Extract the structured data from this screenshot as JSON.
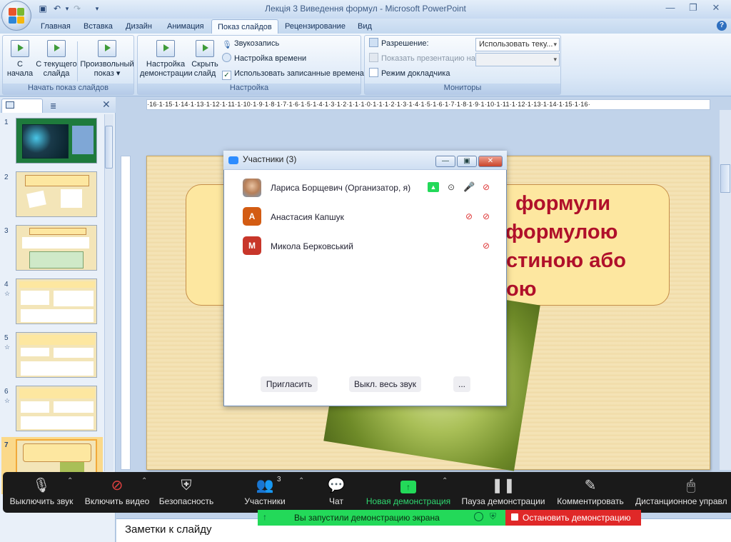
{
  "window": {
    "title": "Лекція 3 Виведення формул - Microsoft PowerPoint"
  },
  "ribbon": {
    "tabs": [
      "Главная",
      "Вставка",
      "Дизайн",
      "Анимация",
      "Показ слайдов",
      "Рецензирование",
      "Вид"
    ],
    "active_tab": "Показ слайдов",
    "start_group": {
      "caption": "Начать показ слайдов",
      "from_start": "С\nначала",
      "from_current": "С текущего\nслайда",
      "custom": "Произвольный\nпоказ ▾"
    },
    "setup_group": {
      "caption": "Настройка",
      "setup_show": "Настройка\nдемонстрации",
      "hide_slide": "Скрыть\nслайд",
      "record_narration": "Звукозапись",
      "rehearse": "Настройка времени",
      "use_timings": "Использовать записанные времена"
    },
    "monitors_group": {
      "caption": "Мониторы",
      "resolution_label": "Разрешение:",
      "resolution_value": "Использовать теку...",
      "show_on_label": "Показать презентацию на:",
      "presenter_view": "Режим докладчика"
    }
  },
  "slides_pane": {
    "numbers": [
      "1",
      "2",
      "3",
      "4",
      "5",
      "6",
      "7"
    ]
  },
  "ruler": {
    "horizontal": "·16·1·15·1·14·1·13·1·12·1·11·1·10·1·9·1·8·1·7·1·6·1·5·1·4·1·3·1·2·1·1·1·0·1·1·1·2·1·3·1·4·1·5·1·6·1·7·1·8·1·9·1·10·1·11·1·12·1·13·1·14·1·15·1·16·"
  },
  "slide": {
    "lines": [
      "формули",
      "формулою",
      "стиною або",
      "ою"
    ]
  },
  "notes": {
    "placeholder": "Заметки к слайду"
  },
  "zoom_participants": {
    "title": "Участники (3)",
    "participants": [
      {
        "name": "Лариса Борщевич (Организатор, я)",
        "initial": "",
        "color": "#8aa0b8"
      },
      {
        "name": "Анастасия Капшук",
        "initial": "A",
        "color": "#d35c13"
      },
      {
        "name": "Микола Берковський",
        "initial": "M",
        "color": "#c8362a"
      }
    ],
    "invite": "Пригласить",
    "mute_all": "Выкл. весь звук",
    "more": "..."
  },
  "zoom_toolbar": {
    "mute": "Выключить звук",
    "video": "Включить видео",
    "security": "Безопасность",
    "participants": "Участники",
    "participants_count": "3",
    "chat": "Чат",
    "new_share": "Новая демонстрация",
    "pause_share": "Пауза демонстрации",
    "annotate": "Комментировать",
    "remote_control": "Дистанционное управл"
  },
  "share_banner": {
    "text": "Вы запустили демонстрацию экрана",
    "stop": "Остановить демонстрацию"
  },
  "colors": {
    "zoom_green": "#23d959",
    "zoom_red": "#e02828",
    "zoom_blue": "#2d8cff",
    "slide_text": "#b0102a"
  }
}
